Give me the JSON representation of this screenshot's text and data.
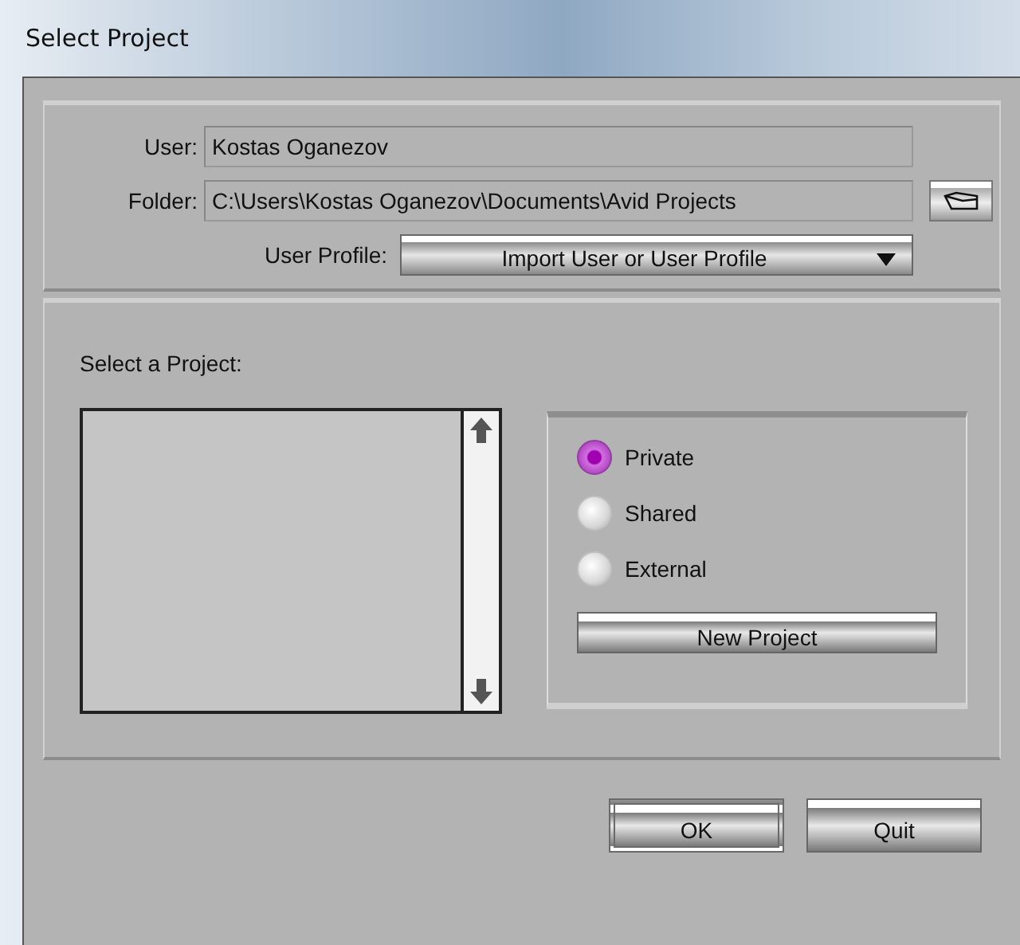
{
  "window": {
    "title": "Select Project"
  },
  "user": {
    "label": "User:",
    "value": "Kostas Oganezov"
  },
  "folder": {
    "label": "Folder:",
    "value": "C:\\Users\\Kostas Oganezov\\Documents\\Avid Projects"
  },
  "user_profile": {
    "label": "User Profile:",
    "value": "Import User or User Profile"
  },
  "project_list": {
    "label": "Select a Project:"
  },
  "project_types": [
    {
      "label": "Private",
      "selected": true
    },
    {
      "label": "Shared",
      "selected": false
    },
    {
      "label": "External",
      "selected": false
    }
  ],
  "new_project_button": "New Project",
  "buttons": [
    {
      "label": "OK",
      "default": true
    },
    {
      "label": "Quit",
      "default": false
    }
  ]
}
